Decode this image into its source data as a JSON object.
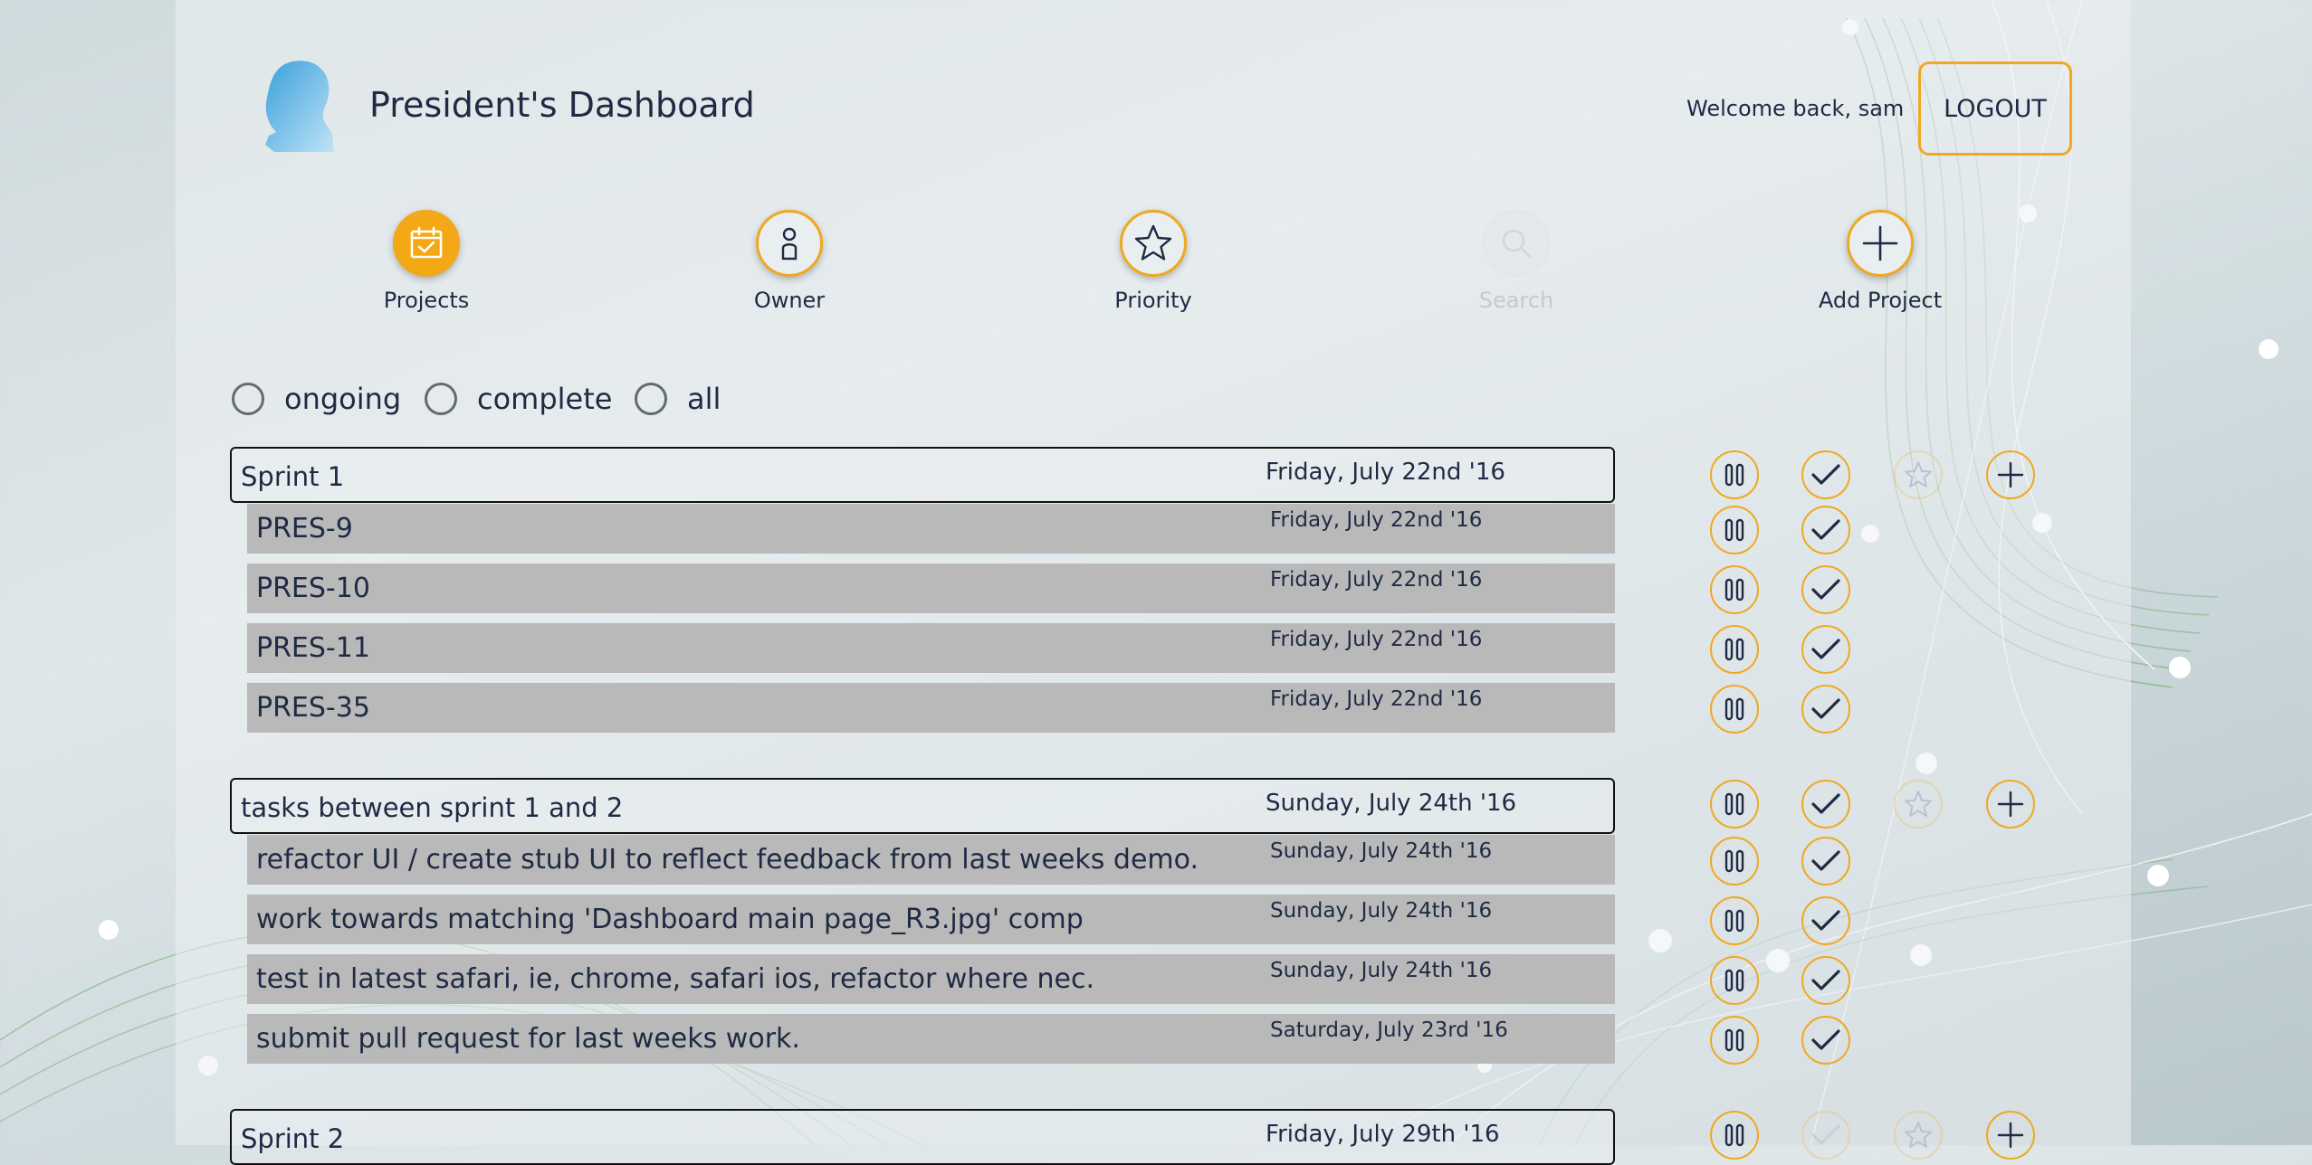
{
  "header": {
    "title": "President's Dashboard",
    "welcome": "Welcome back, sam",
    "logout_label": "LOGOUT"
  },
  "nav": {
    "projects": "Projects",
    "owner": "Owner",
    "priority": "Priority",
    "search": "Search",
    "add_project": "Add Project"
  },
  "filters": {
    "ongoing": "ongoing",
    "complete": "complete",
    "all": "all"
  },
  "groups": [
    {
      "name": "Sprint 1",
      "date": "Friday, July 22nd '16",
      "tasks": [
        {
          "name": "PRES-9",
          "date": "Friday, July 22nd '16"
        },
        {
          "name": "PRES-10",
          "date": "Friday, July 22nd '16"
        },
        {
          "name": "PRES-11",
          "date": "Friday, July 22nd '16"
        },
        {
          "name": "PRES-35",
          "date": "Friday, July 22nd '16"
        }
      ]
    },
    {
      "name": "tasks between sprint 1 and 2",
      "date": "Sunday, July 24th '16",
      "tasks": [
        {
          "name": "refactor UI / create stub UI to reflect feedback from last weeks demo.",
          "date": "Sunday, July 24th '16"
        },
        {
          "name": "work towards matching 'Dashboard main page_R3.jpg' comp",
          "date": "Sunday, July 24th '16"
        },
        {
          "name": "test in latest safari, ie, chrome, safari ios, refactor where nec.",
          "date": "Sunday, July 24th '16"
        },
        {
          "name": "submit pull request for last weeks work.",
          "date": "Saturday, July 23rd '16"
        }
      ]
    },
    {
      "name": "Sprint 2",
      "date": "Friday, July 29th '16",
      "tasks": []
    }
  ],
  "colors": {
    "accent": "#f0a820",
    "navy": "#1f2a44",
    "row_bg": "#b9b9b9"
  }
}
